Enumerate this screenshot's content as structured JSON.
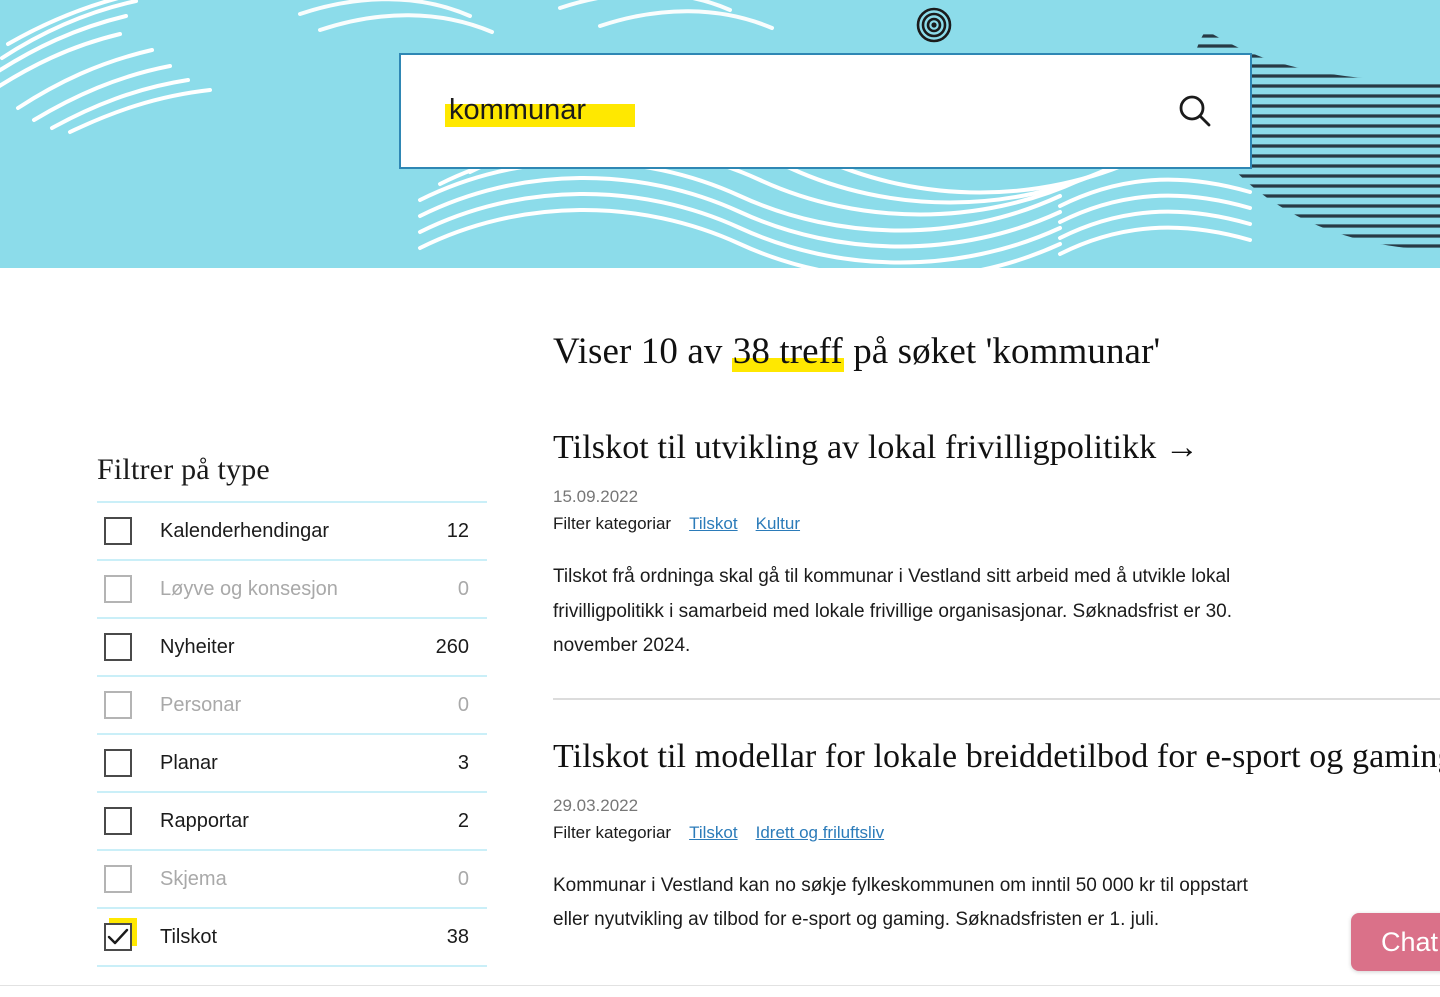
{
  "header": {
    "logo_icon": "target-circles-icon",
    "banner_color": "#8cdcea",
    "accent_highlight": "#ffe800"
  },
  "search": {
    "value": "kommunar",
    "placeholder": "Søk",
    "submit_icon": "search-icon",
    "submit_label": "Søk"
  },
  "sidebar": {
    "title": "Filtrer på type",
    "items": [
      {
        "label": "Kalenderhendingar",
        "count": "12",
        "checked": false,
        "disabled": false
      },
      {
        "label": "Løyve og konsesjon",
        "count": "0",
        "checked": false,
        "disabled": true
      },
      {
        "label": "Nyheiter",
        "count": "260",
        "checked": false,
        "disabled": false
      },
      {
        "label": "Personar",
        "count": "0",
        "checked": false,
        "disabled": true
      },
      {
        "label": "Planar",
        "count": "3",
        "checked": false,
        "disabled": false
      },
      {
        "label": "Rapportar",
        "count": "2",
        "checked": false,
        "disabled": false
      },
      {
        "label": "Skjema",
        "count": "0",
        "checked": false,
        "disabled": true
      },
      {
        "label": "Tilskot",
        "count": "38",
        "checked": true,
        "disabled": false
      }
    ]
  },
  "results": {
    "heading_prefix": "Viser 10 av ",
    "heading_highlight": "38 treff",
    "heading_suffix": " på søket 'kommunar'",
    "category_label": "Filter kategoriar",
    "items": [
      {
        "title": "Tilskot til utvikling av lokal frivilligpolitikk →",
        "date": "15.09.2022",
        "tags": [
          "Tilskot",
          "Kultur"
        ],
        "body": "Tilskot frå ordninga skal gå til kommunar i Vestland sitt arbeid med å utvikle lokal\nfrivilligpolitikk i samarbeid med lokale frivillige organisasjonar. Søknadsfrist er 30.\nnovember 2024."
      },
      {
        "title": "Tilskot til modellar for lokale breiddetilbod for e-sport og gaming",
        "date": "29.03.2022",
        "tags": [
          "Tilskot",
          "Idrett og friluftsliv"
        ],
        "body_line1": "Kommunar i Vestland kan no søkje fylkeskommunen om inntil 50 000 kr til oppstart",
        "body_line2": "eller nyutvikling av tilbod for e-sport og gaming. Søknadsfristen er 1. juli."
      }
    ]
  },
  "chat": {
    "label": "Chat",
    "color": "#da7189"
  }
}
